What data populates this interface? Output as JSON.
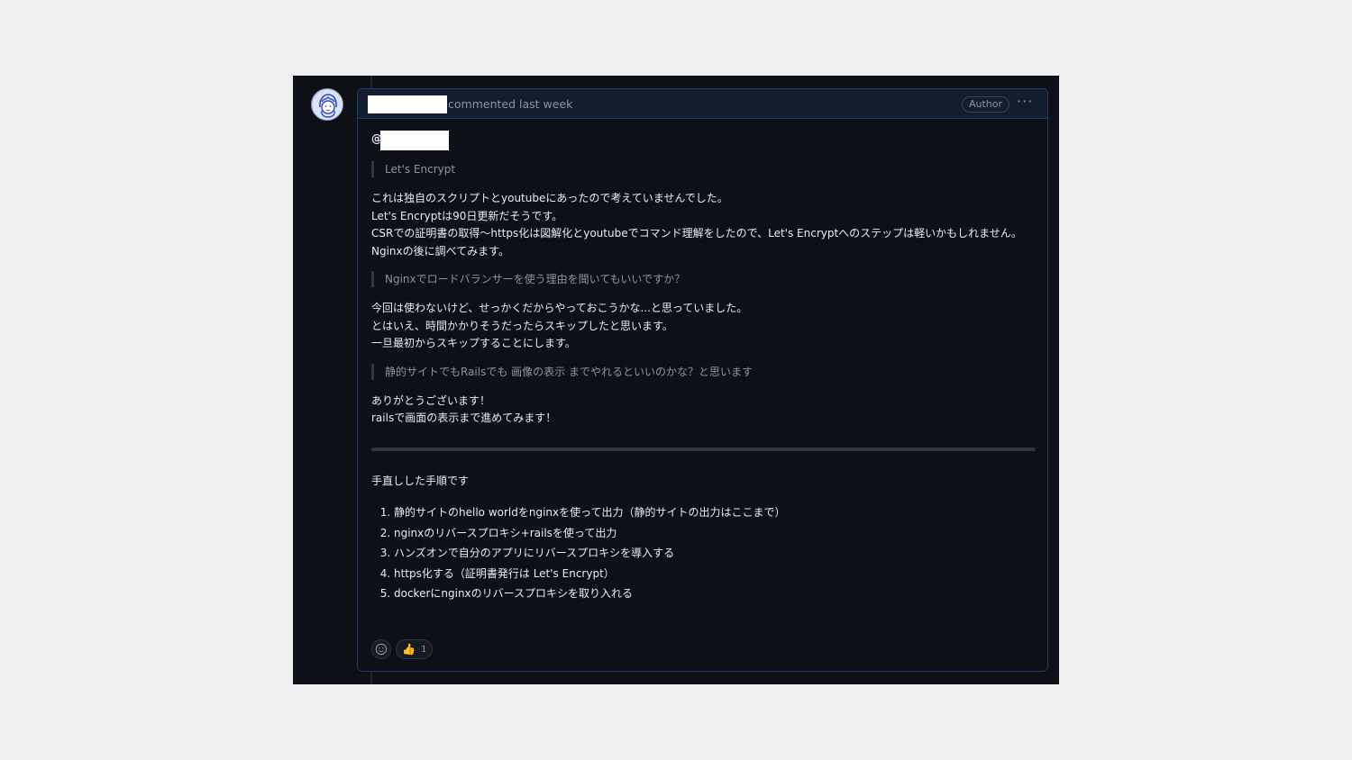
{
  "comment": {
    "header_text": "commented last week",
    "author_badge": "Author",
    "menu_icon": "kebab-horizontal-icon"
  },
  "body": {
    "mention_prefix": "@",
    "quote1": "Let's Encrypt",
    "para1": [
      "これは独自のスクリプトとyoutubeにあったので考えていませんでした。",
      "Let's Encryptは90日更新だそうです。",
      "CSRでの証明書の取得〜https化は図解化とyoutubeでコマンド理解をしたので、Let's Encryptへのステップは軽いかもしれません。",
      "Nginxの後に調べてみます。"
    ],
    "quote2": "Nginxでロードバランサーを使う理由を聞いてもいいですか？",
    "para2": [
      "今回は使わないけど、せっかくだからやっておこうかな...と思っていました。",
      "とはいえ、時間かかりそうだったらスキップしたと思います。",
      "一旦最初からスキップすることにします。"
    ],
    "quote3": "静的サイトでもRailsでも 画像の表示 までやれるといいのかな？と思います",
    "para3": [
      "ありがとうございます！",
      "railsで画面の表示まで進めてみます！"
    ],
    "steps_heading": "手直しした手順です",
    "steps": [
      "静的サイトのhello worldをnginxを使って出力（静的サイトの出力はここまで）",
      "nginxのリバースプロキシ+railsを使って出力",
      "ハンズオンで自分のアプリにリバースプロキシを導入する",
      "https化する（証明書発行は Let's Encrypt）",
      "dockerにnginxのリバースプロキシを取り入れる"
    ]
  },
  "reactions": {
    "add_icon": "smiley-icon",
    "thumbs_emoji": "👍",
    "thumbs_count": "1"
  },
  "colors": {
    "background": "#0d1117",
    "border_accent": "#1f3a66",
    "text": "#e6edf3",
    "muted": "#8b949e"
  }
}
